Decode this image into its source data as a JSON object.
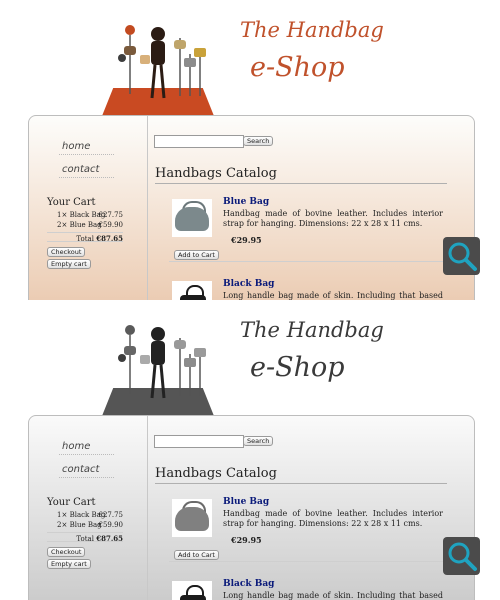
{
  "logo": {
    "line1": "The Handbag",
    "line2": "e-Shop"
  },
  "nav": {
    "items": [
      {
        "label": "home"
      },
      {
        "label": "contact"
      }
    ]
  },
  "cart": {
    "title": "Your Cart",
    "items": [
      {
        "qty": "1×",
        "name": "Black Bag",
        "price": "€27.75"
      },
      {
        "qty": "2×",
        "name": "Blue Bag",
        "price": "€59.90"
      }
    ],
    "total_label": "Total",
    "total_value": "€87.65",
    "checkout_label": "Checkout",
    "empty_label": "Empty cart"
  },
  "search": {
    "value": "",
    "button_label": "Search"
  },
  "catalog": {
    "title": "Handbags Catalog",
    "products": [
      {
        "name": "Blue Bag",
        "description": "Handbag made of bovine leather. Includes interior strap for hanging. Dimensions: 22 x 28 x 11 cms.",
        "price": "€29.95",
        "add_label": "Add to Cart"
      },
      {
        "name": "Black Bag",
        "description": "Long handle bag made of skin. Including that based portfolio"
      }
    ]
  },
  "colors": {
    "accent": "#c0522c",
    "link": "#0a1a7a",
    "zoom_icon": "#1fa3c0"
  },
  "icons": {
    "zoom": "magnifier-icon"
  }
}
